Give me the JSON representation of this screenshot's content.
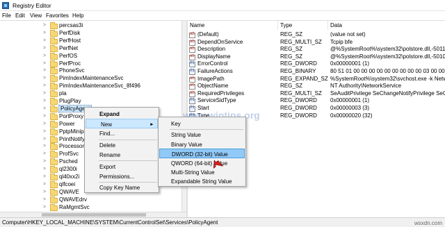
{
  "window": {
    "title": "Registry Editor"
  },
  "menu": [
    "File",
    "Edit",
    "View",
    "Favorites",
    "Help"
  ],
  "tree": {
    "items": [
      "percsas3i",
      "PerfDisk",
      "PerfHost",
      "PerfNet",
      "PerfOS",
      "PerfProc",
      "PhoneSvc",
      "PimIndexMaintenanceSvc",
      "PimIndexMaintenanceSvc_8f496",
      "pla",
      "PlugPlay",
      "PolicyAgent",
      "PortProxy",
      "Power",
      "PptpMinipo",
      "PrintNotify",
      "Processor",
      "ProfSvc",
      "Psched",
      "ql2300i",
      "ql40xx2i",
      "qlfcoei",
      "QWAVE",
      "QWAVEdrv",
      "RaMgmtSvc",
      "RasAcd"
    ],
    "selected": "PolicyAgent"
  },
  "columns": {
    "name": "Name",
    "type": "Type",
    "data": "Data"
  },
  "values": [
    {
      "name": "(Default)",
      "type": "REG_SZ",
      "data": "(value not set)",
      "icon": "string-icon"
    },
    {
      "name": "DependOnService",
      "type": "REG_MULTI_SZ",
      "data": "Tcpip bfe",
      "icon": "string-icon"
    },
    {
      "name": "Description",
      "type": "REG_SZ",
      "data": "@%SystemRoot%\\system32\\polstore.dll,-5011",
      "icon": "string-icon"
    },
    {
      "name": "DisplayName",
      "type": "REG_SZ",
      "data": "@%SystemRoot%\\system32\\polstore.dll,-5010",
      "icon": "string-icon"
    },
    {
      "name": "ErrorControl",
      "type": "REG_DWORD",
      "data": "0x00000001 (1)",
      "icon": "binary-icon"
    },
    {
      "name": "FailureActions",
      "type": "REG_BINARY",
      "data": "80 51 01 00 00 00 00 00 00 00 00 00 03 00 00 00 14 0...",
      "icon": "binary-icon"
    },
    {
      "name": "ImagePath",
      "type": "REG_EXPAND_SZ",
      "data": "%SystemRoot%\\system32\\svchost.exe -k Network...",
      "icon": "string-icon"
    },
    {
      "name": "ObjectName",
      "type": "REG_SZ",
      "data": "NT Authority\\NetworkService",
      "icon": "string-icon"
    },
    {
      "name": "RequiredPrivileges",
      "type": "REG_MULTI_SZ",
      "data": "SeAuditPrivilege SeChangeNotifyPrivilege SeCreat...",
      "icon": "string-icon"
    },
    {
      "name": "ServiceSidType",
      "type": "REG_DWORD",
      "data": "0x00000001 (1)",
      "icon": "binary-icon"
    },
    {
      "name": "Start",
      "type": "REG_DWORD",
      "data": "0x00000003 (3)",
      "icon": "binary-icon"
    },
    {
      "name": "Type",
      "type": "REG_DWORD",
      "data": "0x00000020 (32)",
      "icon": "binary-icon"
    }
  ],
  "context_menu": {
    "items": [
      "Expand",
      "New",
      "Find...",
      "Delete",
      "Rename",
      "Export",
      "Permissions...",
      "Copy Key Name"
    ]
  },
  "submenu": {
    "items": [
      "Key",
      "String Value",
      "Binary Value",
      "DWORD (32-bit) Value",
      "QWORD (64-bit) Value",
      "Multi-String Value",
      "Expandable String Value"
    ],
    "highlighted": "DWORD (32-bit) Value"
  },
  "status": {
    "path": "Computer\\HKEY_LOCAL_MACHINE\\SYSTEM\\CurrentControlSet\\Services\\PolicyAgent"
  },
  "watermark": "www.wintips.org",
  "corner_watermark": "wsxdn.com",
  "colors": {
    "selection": "#cce8ff",
    "highlight": "#91c9f7",
    "folder": "#f7d774"
  }
}
